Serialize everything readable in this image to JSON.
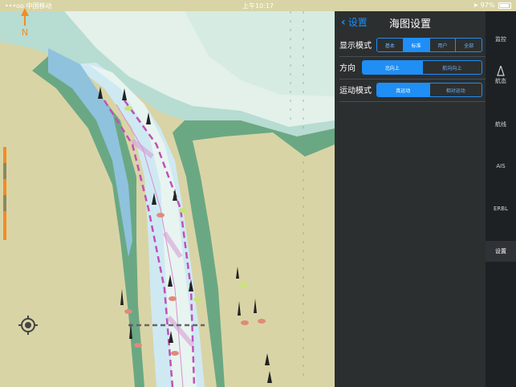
{
  "status_bar": {
    "signal": "•••oo 中国移动",
    "time": "上午10:17",
    "battery": "97%"
  },
  "panel": {
    "back_label": "设置",
    "title": "海图设置",
    "rows": [
      {
        "label": "显示模式",
        "options": [
          "基本",
          "标准",
          "用户",
          "全部"
        ],
        "selected": 1
      },
      {
        "label": "方向",
        "options": [
          "北向上",
          "航向向上"
        ],
        "selected": 0
      },
      {
        "label": "运动模式",
        "options": [
          "真运动",
          "相对运动"
        ],
        "selected": 0
      }
    ]
  },
  "rail": {
    "items": [
      "监控",
      "航态",
      "航线",
      "AIS",
      "ERBL",
      "设置"
    ],
    "active": "设置"
  },
  "compass": {
    "letter": "N"
  },
  "colors": {
    "land": "#d9d4a6",
    "shallow": "#b7dcd2",
    "deep": "#e8f4ee",
    "channel": "#cfe9f3",
    "bank_green": "#6aa883",
    "accent": "#1f8ef5",
    "route": "#c24fb8"
  }
}
